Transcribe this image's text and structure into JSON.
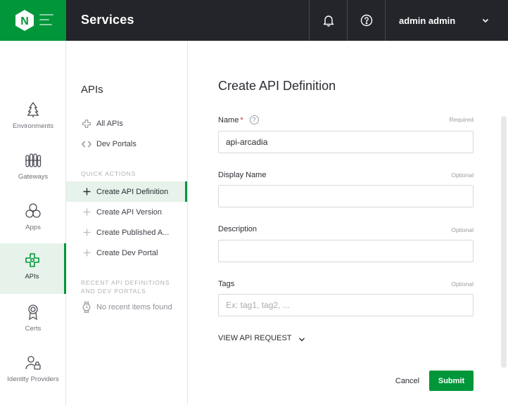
{
  "colors": {
    "brand": "#009639",
    "topbar": "#23252a",
    "active_bg": "#e6f2ea"
  },
  "header": {
    "logo_letter": "N",
    "title": "Services",
    "user_name": "admin admin",
    "icons": [
      "menu-icon",
      "bell-icon",
      "help-icon",
      "chevron-down-icon"
    ]
  },
  "icon_nav": {
    "items": [
      {
        "label": "Environments",
        "icon": "tree-icon",
        "active": false
      },
      {
        "label": "Gateways",
        "icon": "gateway-icon",
        "active": false
      },
      {
        "label": "Apps",
        "icon": "apps-icon",
        "active": false
      },
      {
        "label": "APIs",
        "icon": "api-icon",
        "active": true
      },
      {
        "label": "Certs",
        "icon": "certificate-icon",
        "active": false
      },
      {
        "label": "Identity Providers",
        "icon": "identity-provider-icon",
        "active": false
      }
    ]
  },
  "sub_nav": {
    "title": "APIs",
    "links": [
      {
        "label": "All APIs",
        "icon": "api-small-icon"
      },
      {
        "label": "Dev Portals",
        "icon": "code-icon"
      }
    ],
    "quick_actions_heading": "QUICK ACTIONS",
    "quick_actions": [
      {
        "label": "Create API Definition",
        "active": true
      },
      {
        "label": "Create API Version",
        "active": false
      },
      {
        "label": "Create Published A...",
        "active": false
      },
      {
        "label": "Create Dev Portal",
        "active": false
      }
    ],
    "recent_heading_line1": "RECENT API DEFINITIONS",
    "recent_heading_line2": "AND DEV PORTALS",
    "recent_empty": "No recent items found"
  },
  "form": {
    "title": "Create API Definition",
    "fields": {
      "name": {
        "label": "Name",
        "required_mark": "*",
        "hint": "Required",
        "value": "api-arcadia",
        "help_glyph": "?"
      },
      "display_name": {
        "label": "Display Name",
        "hint": "Optional",
        "value": ""
      },
      "description": {
        "label": "Description",
        "hint": "Optional",
        "value": ""
      },
      "tags": {
        "label": "Tags",
        "hint": "Optional",
        "value": "",
        "placeholder": "Ex: tag1, tag2, ..."
      }
    },
    "view_request_label": "VIEW API REQUEST",
    "cancel_label": "Cancel",
    "submit_label": "Submit"
  }
}
